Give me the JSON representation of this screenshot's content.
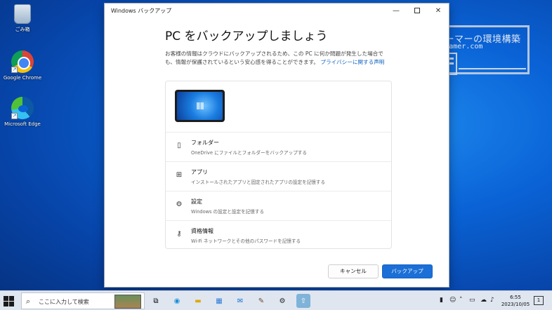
{
  "desktop": {
    "icons": [
      {
        "label": "ごみ箱"
      },
      {
        "label": "Google Chrome"
      },
      {
        "label": "Microsoft Edge"
      }
    ]
  },
  "watermark": {
    "title": "ニッチなＰＣゲーマーの環境構築Ｚ",
    "url": "www.nichepcgamer.com"
  },
  "window": {
    "title": "Windows バックアップ",
    "controls": {
      "minimize": "—",
      "close": "✕"
    },
    "heading": "PC をバックアップしましょう",
    "description": "お客様の情報はクラウドにバックアップされるため、この PC に何か問題が発生した場合でも、情報が保護されているという安心感を得ることができます。",
    "privacy_link": "プライバシーに関する声明",
    "items": [
      {
        "icon": "folder-icon",
        "title": "フォルダー",
        "subtitle": "OneDrive にファイルとフォルダーをバックアップする"
      },
      {
        "icon": "apps-icon",
        "title": "アプリ",
        "subtitle": "インストールされたアプリと固定されたアプリの設定を記憶する"
      },
      {
        "icon": "gear-icon",
        "title": "設定",
        "subtitle": "Windows の設定と設定を記憶する"
      },
      {
        "icon": "key-icon",
        "title": "資格情報",
        "subtitle": "Wi-Fi ネットワークとその他のパスワードを記憶する"
      }
    ],
    "buttons": {
      "cancel": "キャンセル",
      "backup": "バックアップ"
    }
  },
  "taskbar": {
    "search_placeholder": "ここに入力して検索",
    "time": "6:55",
    "date": "2023/10/05",
    "notification_count": "1"
  },
  "colors": {
    "accent": "#1b6fd6",
    "link": "#0a5fbf"
  }
}
